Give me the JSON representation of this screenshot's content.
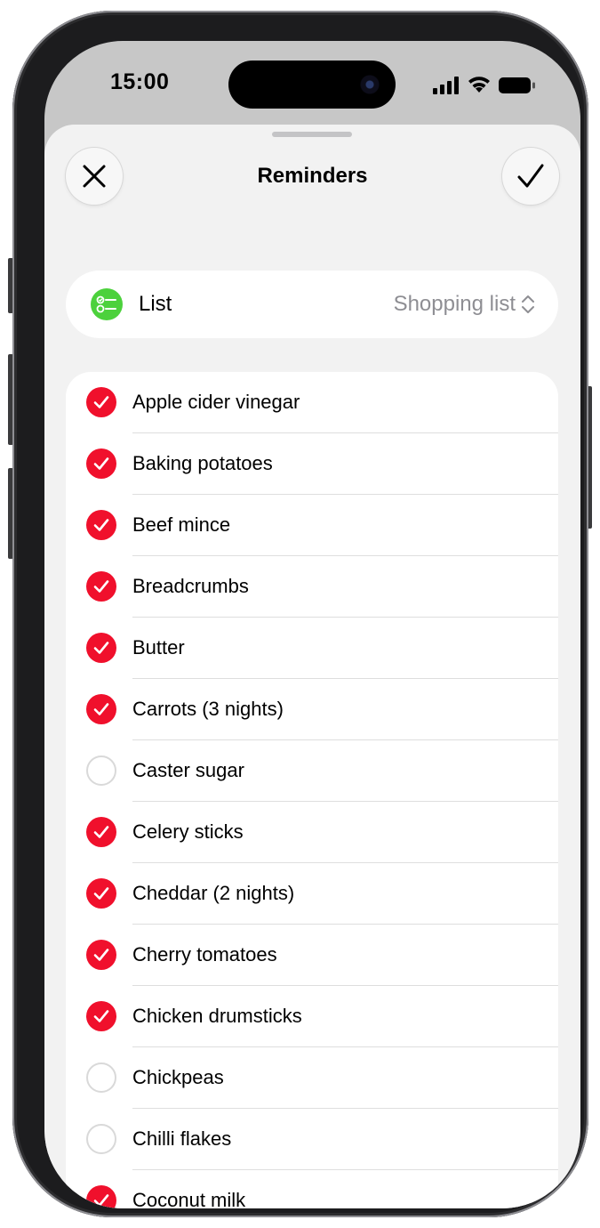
{
  "status_bar": {
    "time": "15:00"
  },
  "sheet": {
    "title": "Reminders"
  },
  "list_selector": {
    "label": "List",
    "value": "Shopping list"
  },
  "items": [
    {
      "label": "Apple cider vinegar",
      "checked": true
    },
    {
      "label": "Baking potatoes",
      "checked": true
    },
    {
      "label": "Beef mince",
      "checked": true
    },
    {
      "label": "Breadcrumbs",
      "checked": true
    },
    {
      "label": "Butter",
      "checked": true
    },
    {
      "label": "Carrots (3 nights)",
      "checked": true
    },
    {
      "label": "Caster sugar",
      "checked": false
    },
    {
      "label": "Celery sticks",
      "checked": true
    },
    {
      "label": "Cheddar (2 nights)",
      "checked": true
    },
    {
      "label": "Cherry tomatoes",
      "checked": true
    },
    {
      "label": "Chicken drumsticks",
      "checked": true
    },
    {
      "label": "Chickpeas",
      "checked": false
    },
    {
      "label": "Chilli flakes",
      "checked": false
    },
    {
      "label": "Coconut milk",
      "checked": true
    }
  ],
  "colors": {
    "check": "#f0102c",
    "list_icon": "#4cd13c"
  }
}
